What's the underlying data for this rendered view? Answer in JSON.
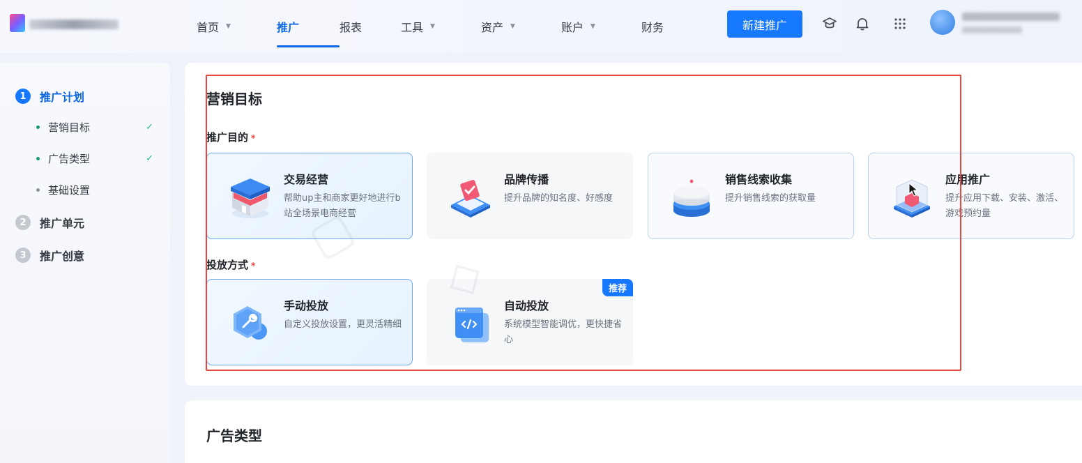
{
  "nav": {
    "items": [
      {
        "label": "首页",
        "caret": true,
        "active": false
      },
      {
        "label": "推广",
        "caret": false,
        "active": true
      },
      {
        "label": "报表",
        "caret": false,
        "active": false
      },
      {
        "label": "工具",
        "caret": true,
        "active": false
      },
      {
        "label": "资产",
        "caret": true,
        "active": false
      },
      {
        "label": "账户",
        "caret": true,
        "active": false
      },
      {
        "label": "财务",
        "caret": false,
        "active": false
      }
    ],
    "new_button": "新建推广",
    "icons": [
      "graduation-cap-icon",
      "bell-icon",
      "apps-grid-icon"
    ]
  },
  "sidebar": {
    "steps": [
      {
        "num": "1",
        "label": "推广计划",
        "active": true,
        "subs": [
          {
            "label": "营销目标",
            "done": true
          },
          {
            "label": "广告类型",
            "done": true
          },
          {
            "label": "基础设置",
            "done": false
          }
        ]
      },
      {
        "num": "2",
        "label": "推广单元",
        "active": false
      },
      {
        "num": "3",
        "label": "推广创意",
        "active": false
      }
    ],
    "check_glyph": "✓"
  },
  "main": {
    "section_title": "营销目标",
    "purpose": {
      "label": "推广目的",
      "required_mark": "*",
      "cards": [
        {
          "title": "交易经营",
          "desc": "帮助up主和商家更好地进行b站全场景电商经营",
          "state": "selected"
        },
        {
          "title": "品牌传播",
          "desc": "提升品牌的知名度、好感度",
          "state": "default"
        },
        {
          "title": "销售线索收集",
          "desc": "提升销售线索的获取量",
          "state": "outlined"
        },
        {
          "title": "应用推广",
          "desc": "提升应用下载、安装、激活、游戏预约量",
          "state": "outlined"
        }
      ]
    },
    "delivery": {
      "label": "投放方式",
      "required_mark": "*",
      "cards": [
        {
          "title": "手动投放",
          "desc": "自定义投放设置，更灵活精细",
          "state": "selected"
        },
        {
          "title": "自动投放",
          "desc": "系统模型智能调优，更快捷省心",
          "state": "default",
          "badge": "推荐"
        }
      ]
    },
    "section2_title": "广告类型"
  },
  "colors": {
    "primary": "#1677ff",
    "active_text": "#0c66e4",
    "success": "#1fb580",
    "required": "#f53f3f",
    "highlight_box": "#e5483f"
  }
}
